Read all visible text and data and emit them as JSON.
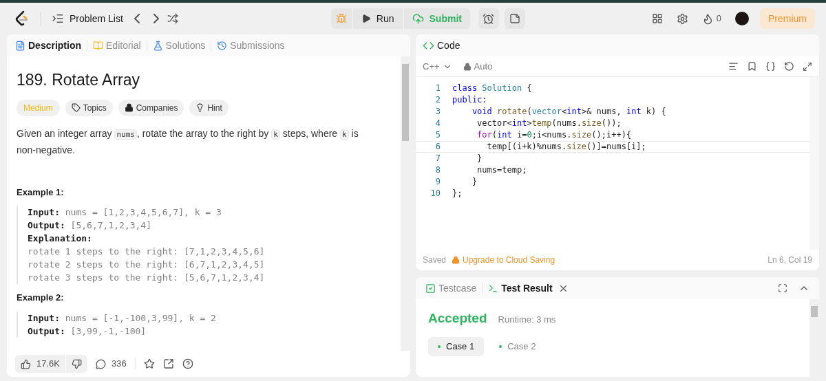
{
  "top_bar": {
    "problem_list": "Problem List",
    "run": "Run",
    "submit": "Submit",
    "streak": "0",
    "premium": "Premium"
  },
  "description_panel": {
    "tabs": [
      {
        "label": "Description",
        "selected": true
      },
      {
        "label": "Editorial",
        "selected": false
      },
      {
        "label": "Solutions",
        "selected": false
      },
      {
        "label": "Submissions",
        "selected": false
      }
    ],
    "title": "189. Rotate Array",
    "difficulty": "Medium",
    "tags": [
      {
        "kind": "topics",
        "label": "Topics"
      },
      {
        "kind": "companies",
        "label": "Companies"
      },
      {
        "kind": "hint",
        "label": "Hint"
      }
    ],
    "statement": [
      {
        "kind": "text",
        "t": "Given an integer array "
      },
      {
        "kind": "code",
        "t": "nums"
      },
      {
        "kind": "text",
        "t": ", rotate the array to the right by "
      },
      {
        "kind": "code",
        "t": "k"
      },
      {
        "kind": "text",
        "t": " steps, where "
      },
      {
        "kind": "code",
        "t": "k"
      },
      {
        "kind": "text",
        "t": " is non-negative."
      }
    ],
    "examples": [
      {
        "title": "Example 1:",
        "lines": [
          {
            "kind": "field",
            "label": "Input:",
            "value": "nums = [1,2,3,4,5,6,7], k = 3"
          },
          {
            "kind": "field",
            "label": "Output:",
            "value": "[5,6,7,1,2,3,4]"
          },
          {
            "kind": "field",
            "label": "Explanation:"
          },
          {
            "kind": "plain",
            "value": "rotate 1 steps to the right: [7,1,2,3,4,5,6]"
          },
          {
            "kind": "plain",
            "value": "rotate 2 steps to the right: [6,7,1,2,3,4,5]"
          },
          {
            "kind": "plain",
            "value": "rotate 3 steps to the right: [5,6,7,1,2,3,4]"
          }
        ]
      },
      {
        "title": "Example 2:",
        "lines": [
          {
            "kind": "field",
            "label": "Input:",
            "value": "nums = [-1,-100,3,99], k = 2"
          },
          {
            "kind": "field",
            "label": "Output:",
            "value": "[3,99,-1,-100]"
          }
        ]
      }
    ],
    "footer": {
      "likes": "17.6K",
      "comments": "336"
    }
  },
  "code_panel": {
    "title": "Code",
    "language": "C++",
    "mode": "Auto",
    "lines": [
      {
        "number": "1",
        "current": false,
        "tokens": [
          {
            "kind": "kw",
            "t": "class "
          },
          {
            "kind": "type",
            "t": "Solution"
          },
          {
            "kind": "plain",
            "t": " {"
          }
        ]
      },
      {
        "number": "2",
        "current": false,
        "tokens": [
          {
            "kind": "kw",
            "t": "public:"
          }
        ]
      },
      {
        "number": "3",
        "current": false,
        "tokens": [
          {
            "kind": "kw",
            "t": "    void "
          },
          {
            "kind": "fn",
            "t": "rotate"
          },
          {
            "kind": "plain",
            "t": "("
          },
          {
            "kind": "type",
            "t": "vector"
          },
          {
            "kind": "plain",
            "t": "<"
          },
          {
            "kind": "kw",
            "t": "int"
          },
          {
            "kind": "plain",
            "t": ">& nums, "
          },
          {
            "kind": "kw",
            "t": "int"
          },
          {
            "kind": "plain",
            "t": " k) {"
          }
        ]
      },
      {
        "number": "4",
        "current": false,
        "tokens": [
          {
            "kind": "plain",
            "t": "     vector<"
          },
          {
            "kind": "kw",
            "t": "int"
          },
          {
            "kind": "plain",
            "t": ">"
          },
          {
            "kind": "fn",
            "t": "temp"
          },
          {
            "kind": "plain",
            "t": "(nums."
          },
          {
            "kind": "fn",
            "t": "size"
          },
          {
            "kind": "plain",
            "t": "());"
          }
        ]
      },
      {
        "number": "5",
        "current": false,
        "tokens": [
          {
            "kind": "ctrl",
            "t": "     for"
          },
          {
            "kind": "plain",
            "t": "("
          },
          {
            "kind": "kw",
            "t": "int"
          },
          {
            "kind": "plain",
            "t": " i="
          },
          {
            "kind": "num",
            "t": "0"
          },
          {
            "kind": "plain",
            "t": ";i<nums."
          },
          {
            "kind": "fn",
            "t": "size"
          },
          {
            "kind": "plain",
            "t": "();i++){"
          }
        ]
      },
      {
        "number": "6",
        "current": true,
        "tokens": [
          {
            "kind": "plain",
            "t": "       temp[(i+k)%nums."
          },
          {
            "kind": "fn",
            "t": "size"
          },
          {
            "kind": "plain",
            "t": "()]=nums[i];"
          }
        ]
      },
      {
        "number": "7",
        "current": false,
        "tokens": [
          {
            "kind": "plain",
            "t": "     }"
          }
        ]
      },
      {
        "number": "8",
        "current": false,
        "tokens": [
          {
            "kind": "plain",
            "t": "     nums=temp;"
          }
        ]
      },
      {
        "number": "9",
        "current": false,
        "tokens": [
          {
            "kind": "plain",
            "t": "    }"
          }
        ]
      },
      {
        "number": "10",
        "current": false,
        "tokens": [
          {
            "kind": "plain",
            "t": "};"
          }
        ]
      }
    ],
    "saved": "Saved",
    "upgrade": "Upgrade to Cloud Saving",
    "cursor": "Ln 6, Col 19"
  },
  "test_panel": {
    "tabs": [
      {
        "kind": "testcase",
        "label": "Testcase",
        "selected": false
      },
      {
        "kind": "result",
        "label": "Test Result",
        "selected": true
      }
    ],
    "verdict": "Accepted",
    "runtime": "Runtime: 3 ms",
    "cases": [
      {
        "label": "Case 1",
        "selected": true
      },
      {
        "label": "Case 2",
        "selected": false
      }
    ]
  }
}
